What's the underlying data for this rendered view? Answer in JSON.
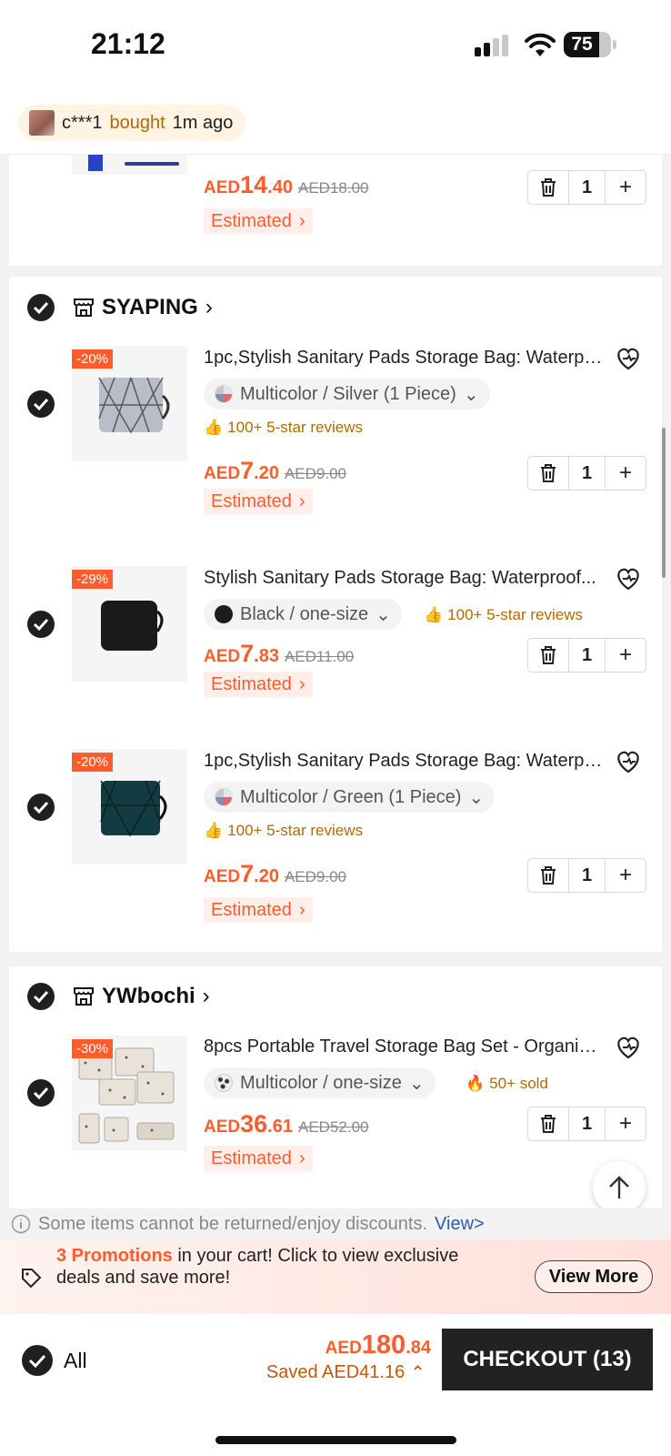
{
  "status": {
    "time": "21:12",
    "battery": "75"
  },
  "toast": {
    "user": "c***1",
    "action": "bought",
    "when": "1m ago"
  },
  "first_item": {
    "price_currency": "AED",
    "price_int": "14",
    "price_dec": ".40",
    "old_price": "AED18.00",
    "estimated": "Estimated",
    "qty": "1"
  },
  "stores": [
    {
      "name": "SYAPING",
      "items": [
        {
          "discount": "-20%",
          "title": "1pc,Stylish Sanitary Pads Storage Bag: Waterproof...",
          "variant": "Multicolor / Silver (1 Piece)",
          "badge": "100+ 5-star reviews",
          "price_currency": "AED",
          "price_int": "7",
          "price_dec": ".20",
          "old_price": "AED9.00",
          "estimated": "Estimated",
          "qty": "1"
        },
        {
          "discount": "-29%",
          "title": "Stylish Sanitary Pads Storage Bag: Waterproof...",
          "variant": "Black / one-size",
          "badge": "100+ 5-star reviews",
          "price_currency": "AED",
          "price_int": "7",
          "price_dec": ".83",
          "old_price": "AED11.00",
          "estimated": "Estimated",
          "qty": "1"
        },
        {
          "discount": "-20%",
          "title": "1pc,Stylish Sanitary Pads Storage Bag: Waterproof...",
          "variant": "Multicolor / Green (1 Piece)",
          "badge": "100+ 5-star reviews",
          "price_currency": "AED",
          "price_int": "7",
          "price_dec": ".20",
          "old_price": "AED9.00",
          "estimated": "Estimated",
          "qty": "1"
        }
      ]
    },
    {
      "name": "YWbochi",
      "items": [
        {
          "discount": "-30%",
          "title": "8pcs Portable Travel Storage Bag Set - Organizer...",
          "variant": "Multicolor / one-size",
          "badge": "50+ sold",
          "price_currency": "AED",
          "price_int": "36",
          "price_dec": ".61",
          "old_price": "AED52.00",
          "estimated": "Estimated",
          "qty": "1"
        }
      ]
    }
  ],
  "notice": {
    "text": "Some items cannot be returned/enjoy discounts.",
    "link": "View>"
  },
  "promo": {
    "highlight": "3 Promotions",
    "text": " in your cart! Click to view exclusive deals and save more!",
    "button": "View More"
  },
  "footer": {
    "all_label": "All",
    "total_currency": "AED",
    "total_int": "180",
    "total_dec": ".84",
    "saved": "Saved AED41.16",
    "checkout": "CHECKOUT (13)"
  },
  "colors": {
    "accent": "#ff5c2b",
    "dark": "#222222",
    "gold": "#b06b00"
  }
}
